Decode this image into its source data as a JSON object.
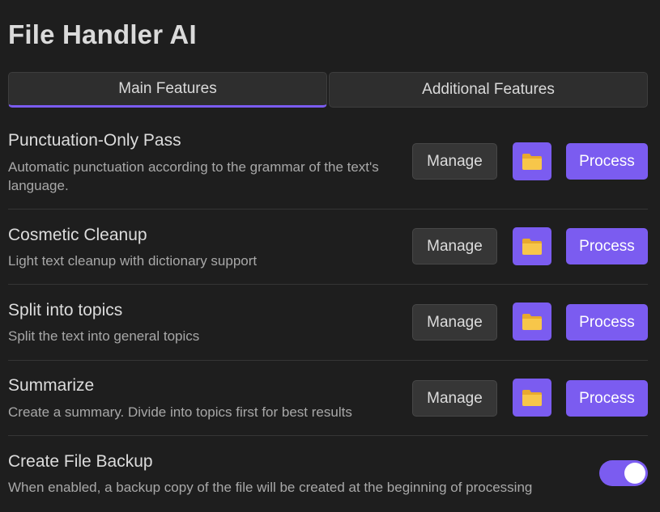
{
  "app": {
    "title": "File Handler AI"
  },
  "tabs": [
    {
      "label": "Main Features",
      "active": true
    },
    {
      "label": "Additional Features",
      "active": false
    }
  ],
  "features": [
    {
      "name": "Punctuation-Only Pass",
      "description": "Automatic punctuation according to the grammar of the text's language.",
      "manage_label": "Manage",
      "folder_icon": "folder-icon",
      "process_label": "Process"
    },
    {
      "name": "Cosmetic Cleanup",
      "description": "Light text cleanup with dictionary support",
      "manage_label": "Manage",
      "folder_icon": "folder-icon",
      "process_label": "Process"
    },
    {
      "name": "Split into topics",
      "description": "Split the text into general topics",
      "manage_label": "Manage",
      "folder_icon": "folder-icon",
      "process_label": "Process"
    },
    {
      "name": "Summarize",
      "description": "Create a summary. Divide into topics first for best results",
      "manage_label": "Manage",
      "folder_icon": "folder-icon",
      "process_label": "Process"
    }
  ],
  "backup": {
    "name": "Create File Backup",
    "description": "When enabled, a backup copy of the file will be created at the beginning of processing",
    "enabled": true
  },
  "colors": {
    "accent": "#7b5cf0",
    "background": "#1e1e1e",
    "folder": "#f7c64a"
  }
}
